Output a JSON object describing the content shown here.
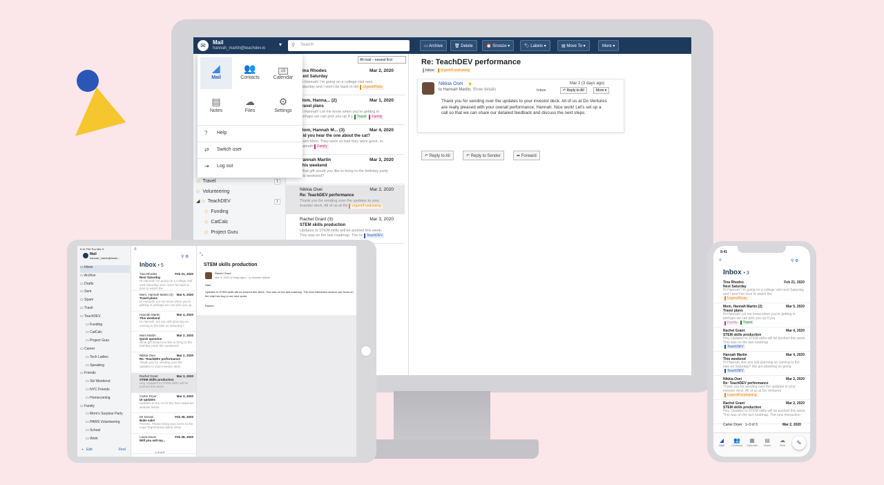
{
  "desktop": {
    "app_title": "Mail",
    "user_email": "hannah_martin@teachdev.io",
    "search_placeholder": "Search",
    "toolbar": {
      "archive": "Archive",
      "delete": "Delete",
      "snooze": "Snooze",
      "labels": "Labels",
      "move_to": "Move To",
      "more": "More"
    },
    "sort": "All mail – newest first",
    "folders": [
      {
        "label": "Travel",
        "count": "1"
      },
      {
        "label": "Volunteering",
        "count": ""
      },
      {
        "label": "TeachDEV",
        "count": "1"
      },
      {
        "label": "Funding",
        "count": ""
      },
      {
        "label": "CatCalc",
        "count": ""
      },
      {
        "label": "Project Guru",
        "count": ""
      }
    ],
    "messages": [
      {
        "from": "Tina Rhodes",
        "date": "Mar 2, 2020",
        "subject": "Next Saturday",
        "preview": "Hi Hannah! I'm going on a college visit next Saturday and I won't be back in tim",
        "tag": "Urgent/Risky"
      },
      {
        "from": "Mom, Hanna... (2)",
        "date": "Mar 1, 2020",
        "subject": "Travel plans",
        "preview": "Hi Hannah! Let me know when you're getting in perhaps we can pick you up if y",
        "tag": "Travel",
        "tag2": "Family"
      },
      {
        "from": "Mom, Hannah M... (3)",
        "date": "Mar 4, 2020",
        "subject": "Did you hear the one about the cat?",
        "preview": "From Mom: They were so bad they were good. xx Hannah",
        "tag": "Family"
      },
      {
        "from": "Hannah Martin",
        "date": "Mar 3, 2020",
        "subject": "This weekend",
        "preview": "What gift would you like to bring to the birthday party this weekend?",
        "tag": ""
      },
      {
        "from": "Nikkia Osei",
        "date": "Mar 2, 2020",
        "subject": "Re: TeachDEV performance",
        "preview": "Thank you for sending over the updates to your investor deck. All of us at Do",
        "tag": "Urgent/Fundraising"
      },
      {
        "from": "Rachel Grant (3)",
        "date": "Mar 3, 2020",
        "subject": "STEM skills production",
        "preview": "Updates to STEM skills will be pushed this week. This was on the last roadmap. The re",
        "tag": "TeachDEV"
      }
    ],
    "apps": [
      "Mail",
      "Contacts",
      "Calendar",
      "Notes",
      "Files",
      "Settings"
    ],
    "calendar_day": "19",
    "menu": [
      "Help",
      "Switch user",
      "Log out"
    ],
    "reader": {
      "title": "Re: TeachDEV performance",
      "tag1": "Inbox",
      "tag2": "Urgent/Fundraising",
      "from": "Nikkia Osei",
      "to": "to Hannah Martin,",
      "show_details": "Show details",
      "date": "Mar 2 (3 days ago)",
      "inbox": "Inbox",
      "reply_all_small": "Reply to All",
      "more_small": "More",
      "body": "Thank you for sending over the updates to your investor deck. All of us at Do Ventures are really pleased with your overall performance, Hannah. Nice work! Let's set up a call so that we can share our detailed feedback and discuss the next steps.",
      "reply_all": "Reply to All",
      "reply_sender": "Reply to Sender",
      "forward": "Forward"
    }
  },
  "tablet": {
    "time": "9:41 PM",
    "date": "Thu Mar 5",
    "app_title": "Mail",
    "user": "hannah_martin@teach...",
    "inbox_title": "Inbox",
    "inbox_count": "5",
    "folders": [
      "Inbox",
      "Archive",
      "Drafts",
      "Sent",
      "Spam",
      "Trash",
      "TeachDEV",
      "Funding",
      "CatCalc",
      "Project Guru",
      "Career",
      "Tech Ladies",
      "Speaking",
      "Friends",
      "Ski Weekend",
      "NYC Friends",
      "Homecoming",
      "Family",
      "Mom's Surprise Party",
      "PAWS Volunteering",
      "School",
      "Work"
    ],
    "edit": "Edit",
    "find": "Find",
    "messages": [
      {
        "from": "Tina Rhodes",
        "date": "Feb 21, 2020",
        "subject": "Next Saturday",
        "preview": "Hi Hannah! I'm going on a college visit next Saturday and I won't be back in time to watch the"
      },
      {
        "from": "Mom, Hannah Martin (2)",
        "date": "Mar 5, 2020",
        "subject": "Travel plans",
        "preview": "Hi Hannah! Let me know when you're getting in perhaps we can pick you up"
      },
      {
        "from": "Hannah Martin",
        "date": "Mar 4, 2020",
        "subject": "This weekend",
        "preview": "Hi Hannah, are you still planning on coming to the lake on Saturday?"
      },
      {
        "from": "Mom Martin",
        "date": "Mar 2, 2020",
        "subject": "Quick question",
        "preview": "What gift would you like to bring to the birthday party this weekend?"
      },
      {
        "from": "Nikkia Osei",
        "date": "Mar 2, 2020",
        "subject": "Re: TeachDEV performance",
        "preview": "Thank you for sending over the updates to your investor deck."
      },
      {
        "from": "Rachel Grant",
        "date": "Mar 3, 2020",
        "subject": "STEM skills production",
        "preview": "Hey, Updates to STEM skills will be pushed this week."
      },
      {
        "from": "Carter Dryer",
        "date": "Mar 3, 2020",
        "subject": "UI updates",
        "preview": "Updates to the UI for the Tech Bakeries website below."
      },
      {
        "from": "Mr Sensei",
        "date": "Feb 28, 2020",
        "subject": "Bake sale!",
        "preview": "Parents, Please bring your items to the Lego Tegnerstone talent show"
      },
      {
        "from": "Laura Davis",
        "date": "Feb 28, 2020",
        "subject": "Will you sell my...",
        "preview": ""
      }
    ],
    "reader": {
      "title": "STEM skills production",
      "from": "Rachel Grant",
      "meta": "Mar 3, 2020 (2 days ago) – to Hannah Martin",
      "greeting": "Hani,",
      "body": "Updates to STEM skills will be pushed this week. This was on the last roadmap. The new interaction section can focus on the chat box bug in our next sprint.",
      "sign": "Rachel"
    },
    "pager": "1–8 of 8"
  },
  "phone": {
    "time": "9:41",
    "inbox_title": "Inbox",
    "inbox_count": "3",
    "messages": [
      {
        "from": "Tina Rhodes",
        "date": "Feb 21, 2020",
        "subject": "Next Saturday",
        "preview": "Hi Hannah! I'm going on a college visit next Saturday and I won't be here to watch the",
        "tag": "Urgent/Risky"
      },
      {
        "from": "Mom, Hannah Martin (2)",
        "date": "Mar 5, 2020",
        "subject": "Travel plans",
        "preview": "Hi Hannah! Let me know when you're getting in perhaps we can pick you up if you",
        "tag": "Travel",
        "tag2": "Family"
      },
      {
        "from": "Rachel Grant",
        "date": "Mar 4, 2020",
        "subject": "STEM skills production",
        "preview": "Hey, Updates to STEM skills will be pushed this week. This was on the last roadmap",
        "tag": "TeachDEV"
      },
      {
        "from": "Hannah Martin",
        "date": "Mar 4, 2020",
        "subject": "This weekend",
        "preview": "Hi Hannah, Are you still planning on coming to the lake on Saturday? We are planning on going",
        "tag": "TeachDEV"
      },
      {
        "from": "Nikkia Osei",
        "date": "Mar 2, 2020",
        "subject": "Re: TeachDEV performance",
        "preview": "Thank you for sending over the updates to your investor deck. All of us at Do Ventures",
        "tag": "Urgent/Fundraising"
      },
      {
        "from": "Rachel Grant",
        "date": "Mar 2, 2020",
        "subject": "STEM skills production",
        "preview": "Hey, Updates to STEM skills will be pushed this week. This was on the last roadmap. The new interaction",
        "tag": ""
      }
    ],
    "last_from": "Carter Dryer",
    "last_count": "1–3 of 3",
    "last_date": "Mar 2, 2020",
    "tabs": [
      "Mail",
      "Contacts",
      "Calendar",
      "Notes",
      "Files"
    ]
  },
  "colors": {
    "background": "#fbe6ea",
    "topbar": "#1d3a5c",
    "accent": "#2c55b8",
    "triangle": "#f5c62e"
  }
}
